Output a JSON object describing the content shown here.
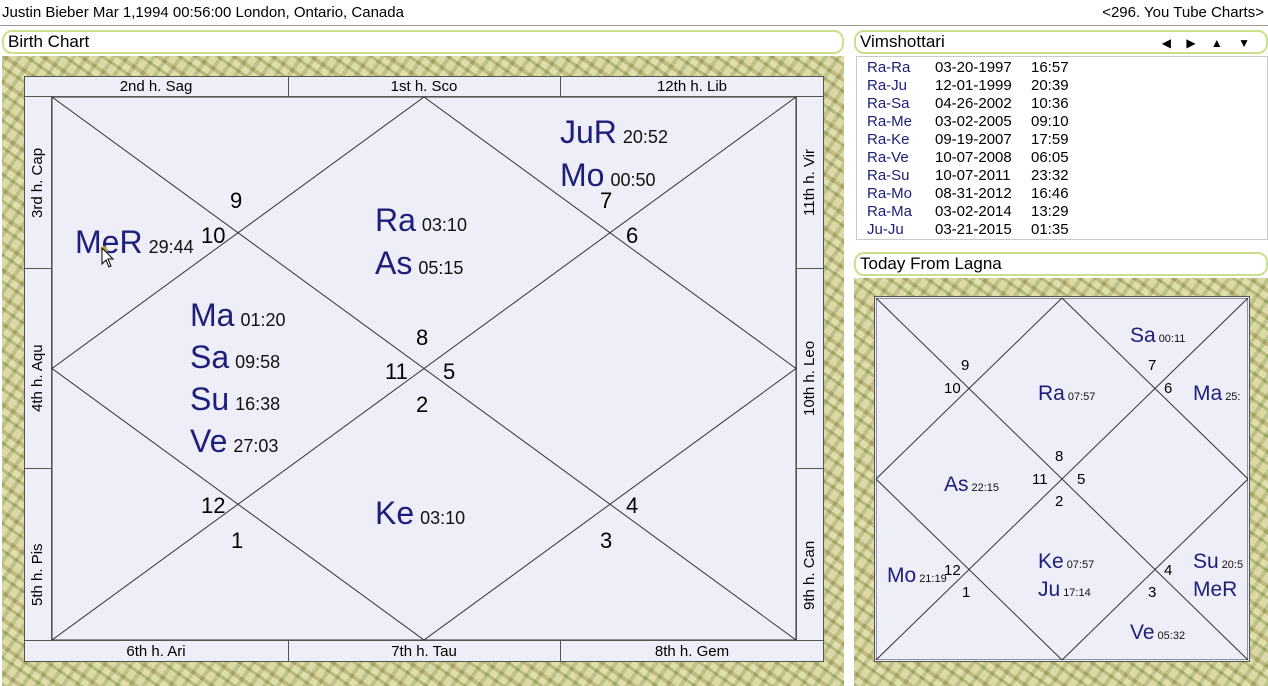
{
  "title": {
    "left": "Justin Bieber Mar 1,1994 00:56:00  London, Ontario, Canada",
    "right": "<296. You Tube Charts>"
  },
  "birth_chart": {
    "header": "Birth Chart",
    "houses_top": [
      "2nd h.  Sag",
      "1st h.  Sco",
      "12th h.  Lib"
    ],
    "houses_bottom": [
      "6th h.  Ari",
      "7th h.  Tau",
      "8th h.  Gem"
    ],
    "houses_left": [
      "3rd h.  Cap",
      "4th h.  Aqu",
      "5th h.  Pis"
    ],
    "houses_right": [
      "11th h.  Vir",
      "10th h.  Leo",
      "9th h.  Can"
    ],
    "house_numbers": [
      "9",
      "10",
      "7",
      "6",
      "8",
      "11",
      "5",
      "2",
      "12",
      "1",
      "4",
      "3"
    ],
    "planets": [
      {
        "name": "JuR",
        "deg": "20:52"
      },
      {
        "name": "Mo",
        "deg": "00:50"
      },
      {
        "name": "Ra",
        "deg": "03:10"
      },
      {
        "name": "As",
        "deg": "05:15"
      },
      {
        "name": "MeR",
        "deg": "29:44"
      },
      {
        "name": "Ma",
        "deg": "01:20"
      },
      {
        "name": "Sa",
        "deg": "09:58"
      },
      {
        "name": "Su",
        "deg": "16:38"
      },
      {
        "name": "Ve",
        "deg": "27:03"
      },
      {
        "name": "Ke",
        "deg": "03:10"
      }
    ]
  },
  "vimshottari": {
    "header": "Vimshottari",
    "nav": "◀ ▶ ▲ ▼",
    "rows": [
      {
        "name": "Ra-Ra",
        "date": "03-20-1997",
        "time": "16:57"
      },
      {
        "name": "Ra-Ju",
        "date": "12-01-1999",
        "time": "20:39"
      },
      {
        "name": "Ra-Sa",
        "date": "04-26-2002",
        "time": "10:36"
      },
      {
        "name": "Ra-Me",
        "date": "03-02-2005",
        "time": "09:10"
      },
      {
        "name": "Ra-Ke",
        "date": "09-19-2007",
        "time": "17:59"
      },
      {
        "name": "Ra-Ve",
        "date": "10-07-2008",
        "time": "06:05"
      },
      {
        "name": "Ra-Su",
        "date": "10-07-2011",
        "time": "23:32"
      },
      {
        "name": "Ra-Mo",
        "date": "08-31-2012",
        "time": "16:46"
      },
      {
        "name": "Ra-Ma",
        "date": "03-02-2014",
        "time": "13:29"
      },
      {
        "name": "Ju-Ju",
        "date": "03-21-2015",
        "time": "01:35"
      }
    ]
  },
  "today_chart": {
    "header": "Today From Lagna",
    "house_numbers": [
      "9",
      "10",
      "7",
      "6",
      "8",
      "11",
      "5",
      "2",
      "12",
      "1",
      "4",
      "3"
    ],
    "planets": [
      {
        "name": "Sa",
        "deg": "00:11"
      },
      {
        "name": "Ra",
        "deg": "07:57"
      },
      {
        "name": "Ma",
        "deg": "25:"
      },
      {
        "name": "As",
        "deg": "22:15"
      },
      {
        "name": "Ke",
        "deg": "07:57"
      },
      {
        "name": "Ju",
        "deg": "17:14"
      },
      {
        "name": "Mo",
        "deg": "21:19"
      },
      {
        "name": "Su",
        "deg": "20:5"
      },
      {
        "name": "MeR",
        "deg": ""
      },
      {
        "name": "Ve",
        "deg": "05:32"
      }
    ]
  }
}
